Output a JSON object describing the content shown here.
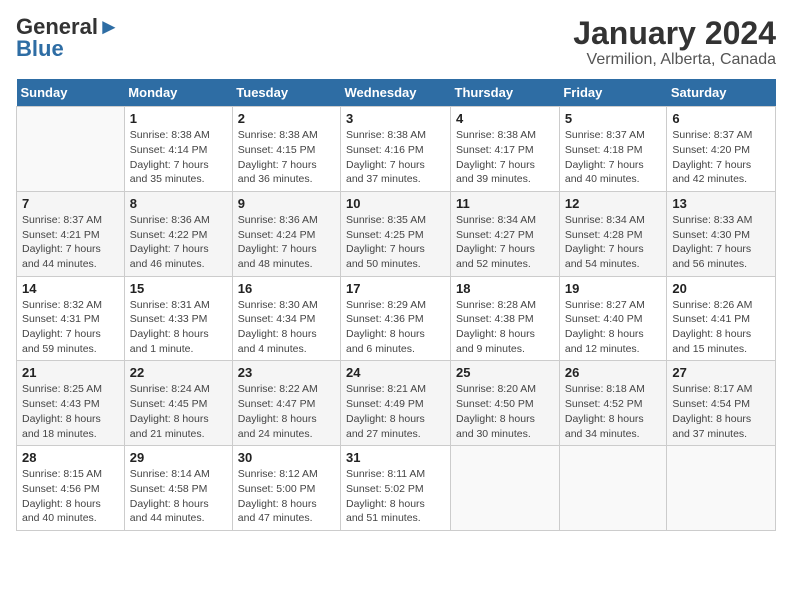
{
  "header": {
    "logo_general": "General",
    "logo_blue": "Blue",
    "title": "January 2024",
    "subtitle": "Vermilion, Alberta, Canada"
  },
  "calendar": {
    "days_of_week": [
      "Sunday",
      "Monday",
      "Tuesday",
      "Wednesday",
      "Thursday",
      "Friday",
      "Saturday"
    ],
    "weeks": [
      [
        {
          "day": "",
          "info": ""
        },
        {
          "day": "1",
          "info": "Sunrise: 8:38 AM\nSunset: 4:14 PM\nDaylight: 7 hours\nand 35 minutes."
        },
        {
          "day": "2",
          "info": "Sunrise: 8:38 AM\nSunset: 4:15 PM\nDaylight: 7 hours\nand 36 minutes."
        },
        {
          "day": "3",
          "info": "Sunrise: 8:38 AM\nSunset: 4:16 PM\nDaylight: 7 hours\nand 37 minutes."
        },
        {
          "day": "4",
          "info": "Sunrise: 8:38 AM\nSunset: 4:17 PM\nDaylight: 7 hours\nand 39 minutes."
        },
        {
          "day": "5",
          "info": "Sunrise: 8:37 AM\nSunset: 4:18 PM\nDaylight: 7 hours\nand 40 minutes."
        },
        {
          "day": "6",
          "info": "Sunrise: 8:37 AM\nSunset: 4:20 PM\nDaylight: 7 hours\nand 42 minutes."
        }
      ],
      [
        {
          "day": "7",
          "info": "Sunrise: 8:37 AM\nSunset: 4:21 PM\nDaylight: 7 hours\nand 44 minutes."
        },
        {
          "day": "8",
          "info": "Sunrise: 8:36 AM\nSunset: 4:22 PM\nDaylight: 7 hours\nand 46 minutes."
        },
        {
          "day": "9",
          "info": "Sunrise: 8:36 AM\nSunset: 4:24 PM\nDaylight: 7 hours\nand 48 minutes."
        },
        {
          "day": "10",
          "info": "Sunrise: 8:35 AM\nSunset: 4:25 PM\nDaylight: 7 hours\nand 50 minutes."
        },
        {
          "day": "11",
          "info": "Sunrise: 8:34 AM\nSunset: 4:27 PM\nDaylight: 7 hours\nand 52 minutes."
        },
        {
          "day": "12",
          "info": "Sunrise: 8:34 AM\nSunset: 4:28 PM\nDaylight: 7 hours\nand 54 minutes."
        },
        {
          "day": "13",
          "info": "Sunrise: 8:33 AM\nSunset: 4:30 PM\nDaylight: 7 hours\nand 56 minutes."
        }
      ],
      [
        {
          "day": "14",
          "info": "Sunrise: 8:32 AM\nSunset: 4:31 PM\nDaylight: 7 hours\nand 59 minutes."
        },
        {
          "day": "15",
          "info": "Sunrise: 8:31 AM\nSunset: 4:33 PM\nDaylight: 8 hours\nand 1 minute."
        },
        {
          "day": "16",
          "info": "Sunrise: 8:30 AM\nSunset: 4:34 PM\nDaylight: 8 hours\nand 4 minutes."
        },
        {
          "day": "17",
          "info": "Sunrise: 8:29 AM\nSunset: 4:36 PM\nDaylight: 8 hours\nand 6 minutes."
        },
        {
          "day": "18",
          "info": "Sunrise: 8:28 AM\nSunset: 4:38 PM\nDaylight: 8 hours\nand 9 minutes."
        },
        {
          "day": "19",
          "info": "Sunrise: 8:27 AM\nSunset: 4:40 PM\nDaylight: 8 hours\nand 12 minutes."
        },
        {
          "day": "20",
          "info": "Sunrise: 8:26 AM\nSunset: 4:41 PM\nDaylight: 8 hours\nand 15 minutes."
        }
      ],
      [
        {
          "day": "21",
          "info": "Sunrise: 8:25 AM\nSunset: 4:43 PM\nDaylight: 8 hours\nand 18 minutes."
        },
        {
          "day": "22",
          "info": "Sunrise: 8:24 AM\nSunset: 4:45 PM\nDaylight: 8 hours\nand 21 minutes."
        },
        {
          "day": "23",
          "info": "Sunrise: 8:22 AM\nSunset: 4:47 PM\nDaylight: 8 hours\nand 24 minutes."
        },
        {
          "day": "24",
          "info": "Sunrise: 8:21 AM\nSunset: 4:49 PM\nDaylight: 8 hours\nand 27 minutes."
        },
        {
          "day": "25",
          "info": "Sunrise: 8:20 AM\nSunset: 4:50 PM\nDaylight: 8 hours\nand 30 minutes."
        },
        {
          "day": "26",
          "info": "Sunrise: 8:18 AM\nSunset: 4:52 PM\nDaylight: 8 hours\nand 34 minutes."
        },
        {
          "day": "27",
          "info": "Sunrise: 8:17 AM\nSunset: 4:54 PM\nDaylight: 8 hours\nand 37 minutes."
        }
      ],
      [
        {
          "day": "28",
          "info": "Sunrise: 8:15 AM\nSunset: 4:56 PM\nDaylight: 8 hours\nand 40 minutes."
        },
        {
          "day": "29",
          "info": "Sunrise: 8:14 AM\nSunset: 4:58 PM\nDaylight: 8 hours\nand 44 minutes."
        },
        {
          "day": "30",
          "info": "Sunrise: 8:12 AM\nSunset: 5:00 PM\nDaylight: 8 hours\nand 47 minutes."
        },
        {
          "day": "31",
          "info": "Sunrise: 8:11 AM\nSunset: 5:02 PM\nDaylight: 8 hours\nand 51 minutes."
        },
        {
          "day": "",
          "info": ""
        },
        {
          "day": "",
          "info": ""
        },
        {
          "day": "",
          "info": ""
        }
      ]
    ]
  }
}
